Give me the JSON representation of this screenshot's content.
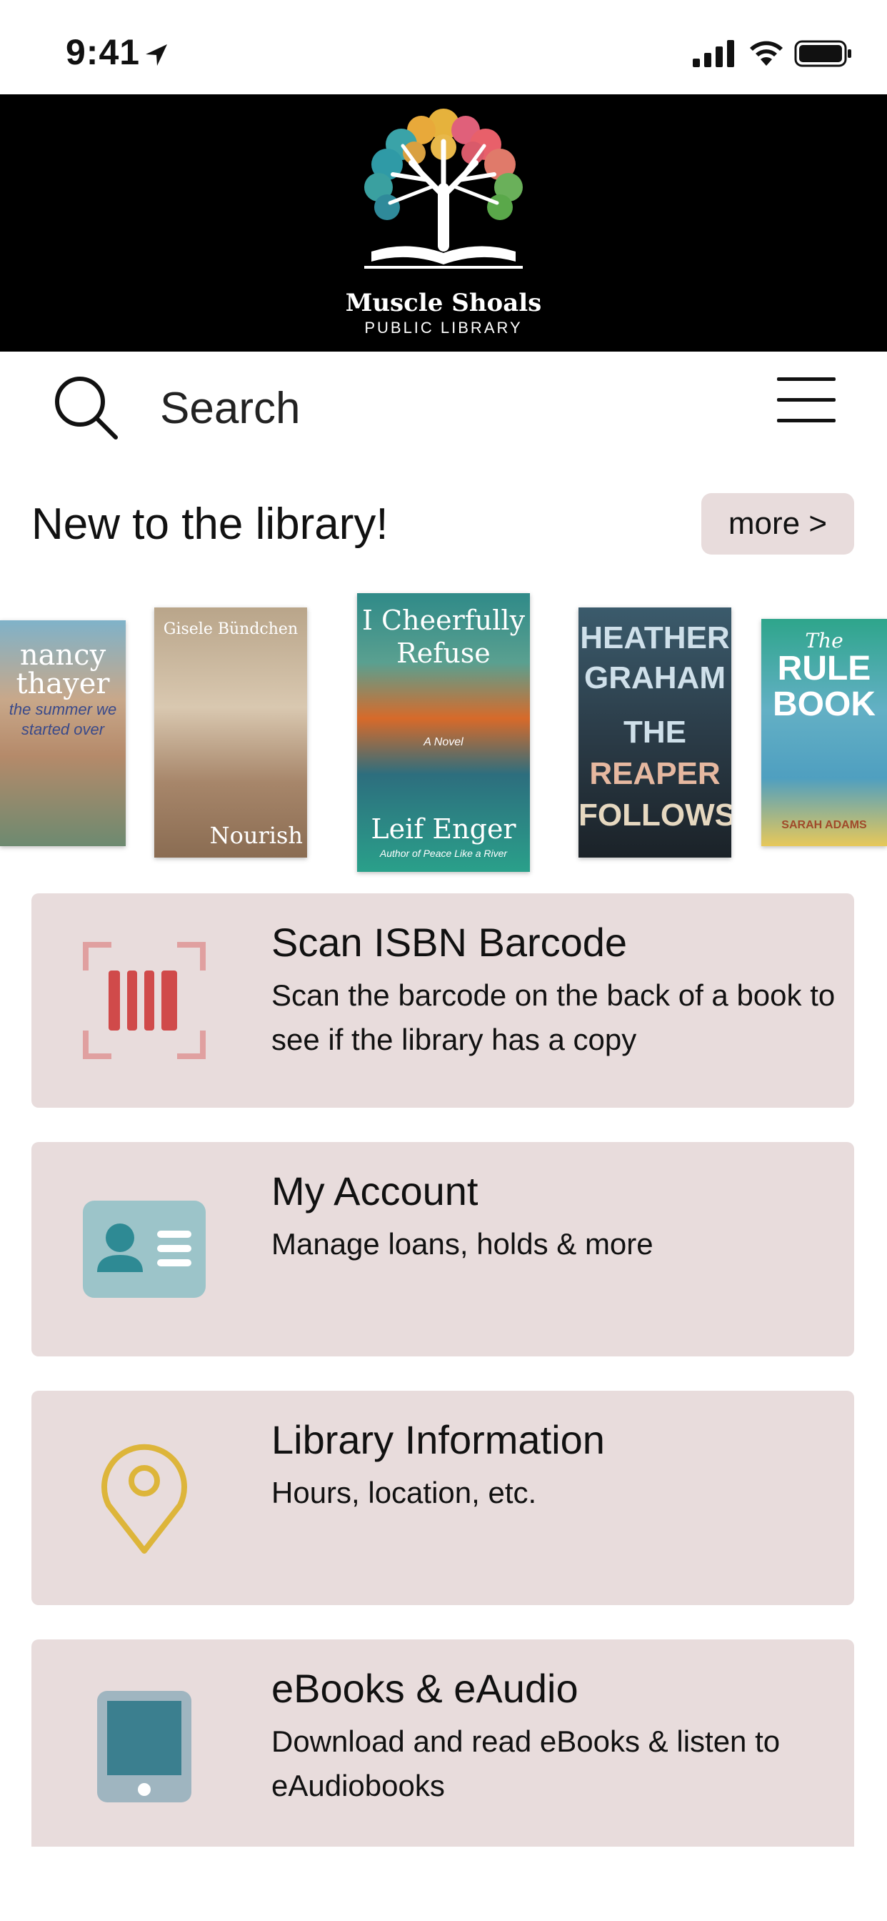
{
  "status_bar": {
    "time": "9:41"
  },
  "header": {
    "logo_name": "Muscle Shoals",
    "logo_sub": "PUBLIC LIBRARY"
  },
  "search": {
    "placeholder": "Search"
  },
  "new_section": {
    "title": "New to the library!",
    "more_label": "more >"
  },
  "books": [
    {
      "lines": [
        "nancy",
        "thayer",
        "the summer we",
        "started over"
      ]
    },
    {
      "lines": [
        "Gisele Bündchen",
        "Nourish"
      ]
    },
    {
      "lines": [
        "I Cheerfully",
        "Refuse",
        "A Novel",
        "Leif Enger",
        "Author of Peace Like a River"
      ]
    },
    {
      "lines": [
        "HEATHER",
        "GRAHAM",
        "THE",
        "REAPER",
        "FOLLOWS"
      ]
    },
    {
      "lines": [
        "The",
        "RULE",
        "BOOK",
        "SARAH ADAMS"
      ]
    }
  ],
  "cards": [
    {
      "title": "Scan ISBN Barcode",
      "desc": "Scan the barcode on the back of a book to see if the library has a copy",
      "icon": "barcode-icon"
    },
    {
      "title": "My Account",
      "desc": "Manage loans, holds & more",
      "icon": "id-card-icon"
    },
    {
      "title": "Library Information",
      "desc": "Hours, location, etc.",
      "icon": "map-pin-icon"
    },
    {
      "title": "eBooks & eAudio",
      "desc": "Download and read eBooks & listen to eAudiobooks",
      "icon": "tablet-icon"
    }
  ],
  "colors": {
    "header_bg": "#000000",
    "card_bg": "#e8dcdc",
    "barcode_red": "#d04a4a",
    "barcode_bracket": "#e0a0a0",
    "account_bg": "#9cc4c9",
    "account_fg": "#2e8a94",
    "pin_yellow": "#ddb53a",
    "tablet_frame": "#9fb5c0",
    "tablet_screen": "#3b7f8f"
  }
}
